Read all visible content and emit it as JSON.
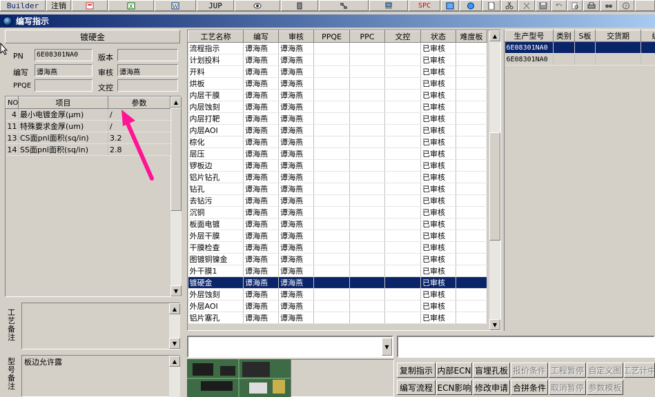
{
  "toolbar": {
    "builder": "Builder",
    "logout": "注销",
    "jup": "JUP",
    "spc": "SPC"
  },
  "window_title": "编写指示",
  "left": {
    "section_title": "镀硬金",
    "pn_label": "PN",
    "pn_value": "6E08301NA0",
    "version_label": "版本",
    "version_value": "",
    "writer_label": "编写",
    "writer_value": "谭海燕",
    "reviewer_label": "审核",
    "reviewer_value": "谭海燕",
    "ppqe_label": "PPQE",
    "ppqe_value": "",
    "doc_control_label": "文控",
    "doc_control_value": "",
    "param_columns": [
      "NO",
      "项目",
      "参数"
    ],
    "params": [
      {
        "no": "4",
        "item": "最小电镀金厚(μm)",
        "value": "/"
      },
      {
        "no": "11",
        "item": "特殊要求金厚(um)",
        "value": "/"
      },
      {
        "no": "13",
        "item": "CS面pnl面积(sq/in)",
        "value": "3.2"
      },
      {
        "no": "14",
        "item": "SS面pnl面积(sq/in)",
        "value": "2.8"
      }
    ],
    "process_note_label": "工艺备注",
    "process_note_value": "",
    "model_note_label": "型号备注",
    "model_note_value": "板边允许露"
  },
  "process_table": {
    "columns": [
      "工艺名称",
      "编写",
      "审核",
      "PPQE",
      "PPC",
      "文控",
      "状态",
      "难度板"
    ],
    "rows": [
      [
        "流程指示",
        "谭海燕",
        "谭海燕",
        "",
        "",
        "",
        "已审核",
        ""
      ],
      [
        "计划投料",
        "谭海燕",
        "谭海燕",
        "",
        "",
        "",
        "已审核",
        ""
      ],
      [
        "开料",
        "谭海燕",
        "谭海燕",
        "",
        "",
        "",
        "已审核",
        ""
      ],
      [
        "烘板",
        "谭海燕",
        "谭海燕",
        "",
        "",
        "",
        "已审核",
        ""
      ],
      [
        "内层干膜",
        "谭海燕",
        "谭海燕",
        "",
        "",
        "",
        "已审核",
        ""
      ],
      [
        "内层蚀刻",
        "谭海燕",
        "谭海燕",
        "",
        "",
        "",
        "已审核",
        ""
      ],
      [
        "内层打靶",
        "谭海燕",
        "谭海燕",
        "",
        "",
        "",
        "已审核",
        ""
      ],
      [
        "内层AOI",
        "谭海燕",
        "谭海燕",
        "",
        "",
        "",
        "已审核",
        ""
      ],
      [
        "棕化",
        "谭海燕",
        "谭海燕",
        "",
        "",
        "",
        "已审核",
        ""
      ],
      [
        "层压",
        "谭海燕",
        "谭海燕",
        "",
        "",
        "",
        "已审核",
        ""
      ],
      [
        "锣板边",
        "谭海燕",
        "谭海燕",
        "",
        "",
        "",
        "已审核",
        ""
      ],
      [
        "铝片钻孔",
        "谭海燕",
        "谭海燕",
        "",
        "",
        "",
        "已审核",
        ""
      ],
      [
        "钻孔",
        "谭海燕",
        "谭海燕",
        "",
        "",
        "",
        "已审核",
        ""
      ],
      [
        "去钻污",
        "谭海燕",
        "谭海燕",
        "",
        "",
        "",
        "已审核",
        ""
      ],
      [
        "沉铜",
        "谭海燕",
        "谭海燕",
        "",
        "",
        "",
        "已审核",
        ""
      ],
      [
        "板面电镀",
        "谭海燕",
        "谭海燕",
        "",
        "",
        "",
        "已审核",
        ""
      ],
      [
        "外层干膜",
        "谭海燕",
        "谭海燕",
        "",
        "",
        "",
        "已审核",
        ""
      ],
      [
        "干膜检查",
        "谭海燕",
        "谭海燕",
        "",
        "",
        "",
        "已审核",
        ""
      ],
      [
        "图镀铜镍金",
        "谭海燕",
        "谭海燕",
        "",
        "",
        "",
        "已审核",
        ""
      ],
      [
        "外干膜1",
        "谭海燕",
        "谭海燕",
        "",
        "",
        "",
        "已审核",
        ""
      ],
      [
        "镀硬金",
        "谭海燕",
        "谭海燕",
        "",
        "",
        "",
        "已审核",
        ""
      ],
      [
        "外层蚀刻",
        "谭海燕",
        "谭海燕",
        "",
        "",
        "",
        "已审核",
        ""
      ],
      [
        "外层AOI",
        "谭海燕",
        "谭海燕",
        "",
        "",
        "",
        "已审核",
        ""
      ],
      [
        "铝片塞孔",
        "谭海燕",
        "谭海燕",
        "",
        "",
        "",
        "已审核",
        ""
      ]
    ],
    "selected_index": 20
  },
  "right_table": {
    "columns": [
      "生产型号",
      "类别",
      "S板",
      "交货期",
      "编"
    ],
    "rows": [
      [
        "6E08301NA0",
        "",
        "",
        "",
        ""
      ],
      [
        "6E08301NA0",
        "",
        "",
        "",
        ""
      ]
    ]
  },
  "buttons_row1": [
    {
      "label": "复制指示",
      "enabled": true
    },
    {
      "label": "内部ECN",
      "enabled": true
    },
    {
      "label": "盲埋孔板",
      "enabled": true
    },
    {
      "label": "报价条件",
      "enabled": false
    },
    {
      "label": "工程暂停",
      "enabled": false
    },
    {
      "label": "自定义图",
      "enabled": false
    },
    {
      "label": "工艺计中",
      "enabled": false
    }
  ],
  "buttons_row2": [
    {
      "label": "编写流程",
      "enabled": true
    },
    {
      "label": "ECN影响",
      "enabled": true
    },
    {
      "label": "修改申请",
      "enabled": true
    },
    {
      "label": "合拼条件",
      "enabled": true
    },
    {
      "label": "取消暂停",
      "enabled": false
    },
    {
      "label": "参数模板",
      "enabled": false
    }
  ],
  "colors": {
    "selection": "#0a246a",
    "annotation_arrow": "#ff1493"
  }
}
